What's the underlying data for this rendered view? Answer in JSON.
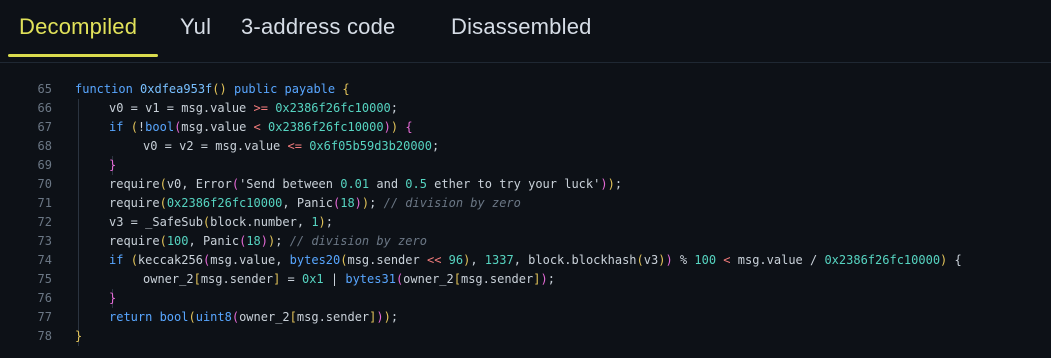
{
  "tabs": [
    {
      "label": "Decompiled",
      "active": true
    },
    {
      "label": "Yul",
      "active": false
    },
    {
      "label": "3-address code",
      "active": false
    },
    {
      "label": "Disassembled",
      "active": false
    }
  ],
  "colors": {
    "background": "#0d1117",
    "active_tab": "#e1e25a",
    "keyword": "#58a6ff",
    "number": "#56d4c1",
    "operator": "#f47c7c",
    "comment": "#6b7785",
    "bracket": "#e3c45a"
  },
  "code": {
    "language": "solidity-like decompiled",
    "lines": [
      {
        "n": "65",
        "indent": 0,
        "tokens": [
          {
            "t": "function ",
            "c": "kw"
          },
          {
            "t": "0xdfea953f",
            "c": "fn"
          },
          {
            "t": "(",
            "c": "br"
          },
          {
            "t": ")",
            "c": "br"
          },
          {
            "t": " public payable ",
            "c": "kw"
          },
          {
            "t": "{",
            "c": "br"
          }
        ]
      },
      {
        "n": "66",
        "indent": 1,
        "tokens": [
          {
            "t": "v0 = v1 = msg.value ",
            "c": ""
          },
          {
            "t": ">=",
            "c": "op"
          },
          {
            "t": " ",
            "c": ""
          },
          {
            "t": "0x2386f26fc10000",
            "c": "num"
          },
          {
            "t": ";",
            "c": ""
          }
        ]
      },
      {
        "n": "67",
        "indent": 1,
        "tokens": [
          {
            "t": "if ",
            "c": "kw"
          },
          {
            "t": "(",
            "c": "br"
          },
          {
            "t": "!",
            "c": ""
          },
          {
            "t": "bool",
            "c": "kw"
          },
          {
            "t": "(",
            "c": "br2"
          },
          {
            "t": "msg.value ",
            "c": ""
          },
          {
            "t": "<",
            "c": "op"
          },
          {
            "t": " ",
            "c": ""
          },
          {
            "t": "0x2386f26fc10000",
            "c": "num"
          },
          {
            "t": ")",
            "c": "br2"
          },
          {
            "t": ")",
            "c": "br"
          },
          {
            "t": " ",
            "c": ""
          },
          {
            "t": "{",
            "c": "br2"
          }
        ]
      },
      {
        "n": "68",
        "indent": 2,
        "tokens": [
          {
            "t": "v0 = v2 = msg.value ",
            "c": ""
          },
          {
            "t": "<=",
            "c": "op"
          },
          {
            "t": " ",
            "c": ""
          },
          {
            "t": "0x6f05b59d3b20000",
            "c": "num"
          },
          {
            "t": ";",
            "c": ""
          }
        ]
      },
      {
        "n": "69",
        "indent": 1,
        "tokens": [
          {
            "t": "}",
            "c": "br2"
          }
        ]
      },
      {
        "n": "70",
        "indent": 1,
        "tokens": [
          {
            "t": "require",
            "c": ""
          },
          {
            "t": "(",
            "c": "br"
          },
          {
            "t": "v0, Error",
            "c": ""
          },
          {
            "t": "(",
            "c": "br2"
          },
          {
            "t": "'Send between ",
            "c": ""
          },
          {
            "t": "0.01",
            "c": "num"
          },
          {
            "t": " and ",
            "c": ""
          },
          {
            "t": "0.5",
            "c": "num"
          },
          {
            "t": " ether to try your luck'",
            "c": ""
          },
          {
            "t": ")",
            "c": "br2"
          },
          {
            "t": ")",
            "c": "br"
          },
          {
            "t": ";",
            "c": ""
          }
        ]
      },
      {
        "n": "71",
        "indent": 1,
        "tokens": [
          {
            "t": "require",
            "c": ""
          },
          {
            "t": "(",
            "c": "br"
          },
          {
            "t": "0x2386f26fc10000",
            "c": "num"
          },
          {
            "t": ", Panic",
            "c": ""
          },
          {
            "t": "(",
            "c": "br2"
          },
          {
            "t": "18",
            "c": "num"
          },
          {
            "t": ")",
            "c": "br2"
          },
          {
            "t": ")",
            "c": "br"
          },
          {
            "t": "; ",
            "c": ""
          },
          {
            "t": "// division by zero",
            "c": "cm"
          }
        ]
      },
      {
        "n": "72",
        "indent": 1,
        "tokens": [
          {
            "t": "v3 = _SafeSub",
            "c": ""
          },
          {
            "t": "(",
            "c": "br"
          },
          {
            "t": "block.number, ",
            "c": ""
          },
          {
            "t": "1",
            "c": "num"
          },
          {
            "t": ")",
            "c": "br"
          },
          {
            "t": ";",
            "c": ""
          }
        ]
      },
      {
        "n": "73",
        "indent": 1,
        "tokens": [
          {
            "t": "require",
            "c": ""
          },
          {
            "t": "(",
            "c": "br"
          },
          {
            "t": "100",
            "c": "num"
          },
          {
            "t": ", Panic",
            "c": ""
          },
          {
            "t": "(",
            "c": "br2"
          },
          {
            "t": "18",
            "c": "num"
          },
          {
            "t": ")",
            "c": "br2"
          },
          {
            "t": ")",
            "c": "br"
          },
          {
            "t": "; ",
            "c": ""
          },
          {
            "t": "// division by zero",
            "c": "cm"
          }
        ]
      },
      {
        "n": "74",
        "indent": 1,
        "tokens": [
          {
            "t": "if ",
            "c": "kw"
          },
          {
            "t": "(",
            "c": "br"
          },
          {
            "t": "keccak256",
            "c": ""
          },
          {
            "t": "(",
            "c": "br2"
          },
          {
            "t": "msg.value, ",
            "c": ""
          },
          {
            "t": "bytes20",
            "c": "kw"
          },
          {
            "t": "(",
            "c": "br"
          },
          {
            "t": "msg.sender ",
            "c": ""
          },
          {
            "t": "<<",
            "c": "op"
          },
          {
            "t": " ",
            "c": ""
          },
          {
            "t": "96",
            "c": "num"
          },
          {
            "t": ")",
            "c": "br"
          },
          {
            "t": ", ",
            "c": ""
          },
          {
            "t": "1337",
            "c": "num"
          },
          {
            "t": ", block.blockhash",
            "c": ""
          },
          {
            "t": "(",
            "c": "br"
          },
          {
            "t": "v3",
            "c": ""
          },
          {
            "t": ")",
            "c": "br"
          },
          {
            "t": ")",
            "c": "br2"
          },
          {
            "t": " % ",
            "c": ""
          },
          {
            "t": "100",
            "c": "num"
          },
          {
            "t": " ",
            "c": ""
          },
          {
            "t": "<",
            "c": "op"
          },
          {
            "t": " msg.value / ",
            "c": ""
          },
          {
            "t": "0x2386f26fc10000",
            "c": "num"
          },
          {
            "t": ")",
            "c": "br"
          },
          {
            "t": " {",
            "c": ""
          }
        ]
      },
      {
        "n": "75",
        "indent": 2,
        "tokens": [
          {
            "t": "owner_2",
            "c": ""
          },
          {
            "t": "[",
            "c": "br"
          },
          {
            "t": "msg.sender",
            "c": ""
          },
          {
            "t": "]",
            "c": "br"
          },
          {
            "t": " = ",
            "c": ""
          },
          {
            "t": "0x1",
            "c": "num"
          },
          {
            "t": " | ",
            "c": ""
          },
          {
            "t": "bytes31",
            "c": "kw"
          },
          {
            "t": "(",
            "c": "br2"
          },
          {
            "t": "owner_2",
            "c": ""
          },
          {
            "t": "[",
            "c": "br"
          },
          {
            "t": "msg.sender",
            "c": ""
          },
          {
            "t": "]",
            "c": "br"
          },
          {
            "t": ")",
            "c": "br2"
          },
          {
            "t": ";",
            "c": ""
          }
        ]
      },
      {
        "n": "76",
        "indent": 1,
        "tokens": [
          {
            "t": "}",
            "c": "br2"
          }
        ]
      },
      {
        "n": "77",
        "indent": 1,
        "tokens": [
          {
            "t": "return ",
            "c": "kw"
          },
          {
            "t": "bool",
            "c": "kw"
          },
          {
            "t": "(",
            "c": "br"
          },
          {
            "t": "uint8",
            "c": "kw"
          },
          {
            "t": "(",
            "c": "br2"
          },
          {
            "t": "owner_2",
            "c": ""
          },
          {
            "t": "[",
            "c": "br"
          },
          {
            "t": "msg.sender",
            "c": ""
          },
          {
            "t": "]",
            "c": "br"
          },
          {
            "t": ")",
            "c": "br2"
          },
          {
            "t": ")",
            "c": "br"
          },
          {
            "t": ";",
            "c": ""
          }
        ]
      },
      {
        "n": "78",
        "indent": 0,
        "tokens": [
          {
            "t": "}",
            "c": "br"
          }
        ]
      }
    ]
  }
}
